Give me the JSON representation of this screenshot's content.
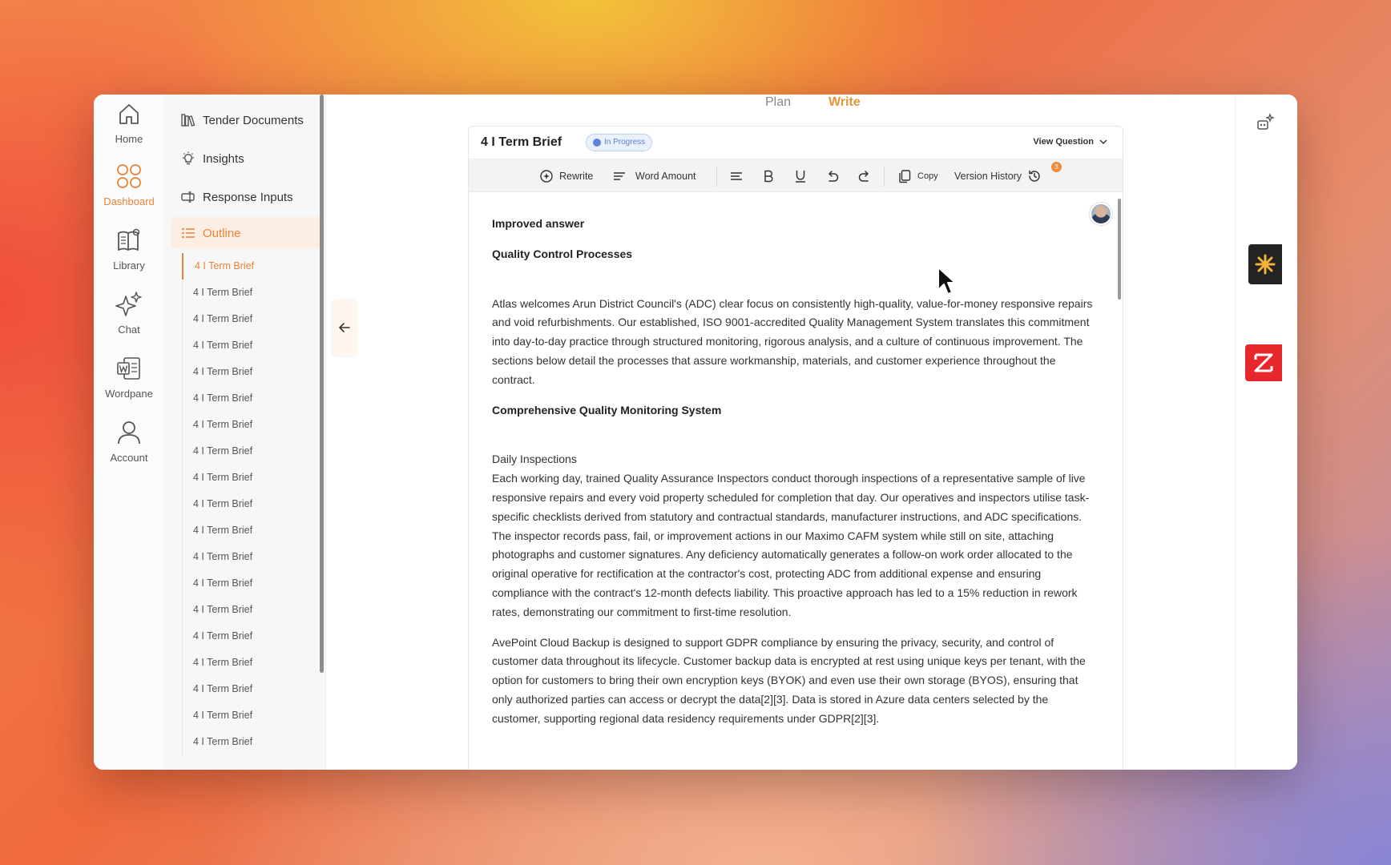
{
  "rail": {
    "items": [
      {
        "label": "Home",
        "icon": "home-icon"
      },
      {
        "label": "Dashboard",
        "icon": "dashboard-icon",
        "active": true
      },
      {
        "label": "Library",
        "icon": "library-icon"
      },
      {
        "label": "Chat",
        "icon": "sparkles-icon"
      },
      {
        "label": "Wordpane",
        "icon": "word-doc-icon"
      },
      {
        "label": "Account",
        "icon": "user-icon"
      }
    ]
  },
  "nav": {
    "items": [
      {
        "label": "Tender Documents",
        "icon": "books-icon"
      },
      {
        "label": "Insights",
        "icon": "lightbulb-icon"
      },
      {
        "label": "Response Inputs",
        "icon": "input-icon"
      },
      {
        "label": "Outline",
        "icon": "list-icon",
        "active": true
      }
    ],
    "sub_items": [
      "4 I Term Brief",
      "4 I Term Brief",
      "4 I Term Brief",
      "4 I Term Brief",
      "4 I Term Brief",
      "4 I Term Brief",
      "4 I Term Brief",
      "4 I Term Brief",
      "4 I Term Brief",
      "4 I Term Brief",
      "4 I Term Brief",
      "4 I Term Brief",
      "4 I Term Brief",
      "4 I Term Brief",
      "4 I Term Brief",
      "4 I Term Brief",
      "4 I Term Brief",
      "4 I Term Brief",
      "4 I Term Brief"
    ]
  },
  "modes": {
    "plan": "Plan",
    "write": "Write"
  },
  "editor": {
    "title": "4 I Term Brief",
    "status": "In Progress",
    "view_question": "View Question",
    "toolbar": {
      "rewrite": "Rewrite",
      "word_amount": "Word Amount",
      "copy": "Copy",
      "version_history": "Version History",
      "version_count": "3"
    },
    "content": {
      "heading1": "Improved answer",
      "heading2": "Quality Control Processes",
      "para1": "Atlas welcomes Arun District Council's (ADC) clear focus on consistently high-quality, value-for-money responsive repairs and void refurbishments. Our established, ISO 9001-accredited Quality Management System translates this commitment into day-to-day practice through structured monitoring, rigorous analysis, and a culture of continuous improvement. The sections below detail the processes that assure workmanship, materials, and customer experience throughout the contract.",
      "heading3": "Comprehensive Quality Monitoring System",
      "subheading": "Daily Inspections",
      "para2": "Each working day, trained Quality Assurance Inspectors conduct thorough inspections of a representative sample of live responsive repairs and every void property scheduled for completion that day. Our operatives and inspectors utilise task-specific checklists derived from statutory and contractual standards, manufacturer instructions, and ADC specifications. The inspector records pass, fail, or improvement actions in our Maximo CAFM system while still on site, attaching photographs and customer signatures. Any deficiency automatically generates a follow-on work order allocated to the original operative for rectification at the contractor's cost, protecting ADC from additional expense and ensuring compliance with the contract's 12-month defects liability. This proactive approach has led to a 15% reduction in rework rates, demonstrating our commitment to first-time resolution.",
      "para3": "AvePoint Cloud Backup is designed to support GDPR compliance by ensuring the privacy, security, and control of customer data throughout its lifecycle. Customer backup data is encrypted at rest using unique keys per tenant, with the option for customers to bring their own encryption keys (BYOK) and even use their own storage (BYOS), ensuring that only authorized parties can access or decrypt the data[2][3]. Data is stored in Azure data centers selected by the customer, supporting regional data residency requirements under GDPR[2][3]."
    }
  },
  "colors": {
    "accent": "#e8843a",
    "status_blue": "#5b86dc",
    "ext_red": "#e6282c"
  }
}
